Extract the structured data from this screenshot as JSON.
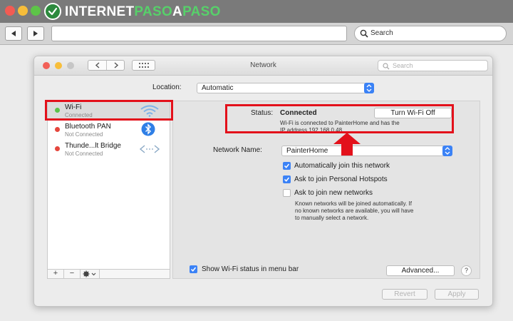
{
  "brand": {
    "part1": "INTERNET",
    "part2": "PASO",
    "part3": "A",
    "part4": "PASO"
  },
  "browser": {
    "search_text": "Search",
    "address_value": ""
  },
  "window": {
    "title": "Network",
    "search_placeholder": "Search",
    "location_label": "Location:",
    "location_value": "Automatic"
  },
  "services": [
    {
      "name": "Wi-Fi",
      "status": "Connected",
      "dot_color": "#5cc24a",
      "icon": "wifi-icon"
    },
    {
      "name": "Bluetooth PAN",
      "status": "Not Connected",
      "dot_color": "#e5463d",
      "icon": "bluetooth-icon"
    },
    {
      "name": "Thunde...lt Bridge",
      "status": "Not Connected",
      "dot_color": "#e5463d",
      "icon": "thunderbolt-bridge-icon"
    }
  ],
  "sidebar_footer": {
    "add": "+",
    "remove": "−"
  },
  "detail": {
    "status_label": "Status:",
    "status_value": "Connected",
    "turn_off_button": "Turn Wi-Fi Off",
    "status_desc_line1": "Wi-Fi is connected to PainterHome and has the",
    "status_desc_line2": "IP address 192.168.0.48.",
    "network_name_label": "Network Name:",
    "network_name_value": "PainterHome",
    "options": [
      {
        "label": "Automatically join this network",
        "checked": true
      },
      {
        "label": "Ask to join Personal Hotspots",
        "checked": true
      },
      {
        "label": "Ask to join new networks",
        "checked": false
      }
    ],
    "note_line1": "Known networks will be joined automatically. If",
    "note_line2": "no known networks are available, you will have",
    "note_line3": "to manually select a network.",
    "show_status_label": "Show Wi-Fi status in menu bar",
    "advanced_button": "Advanced...",
    "help_button": "?"
  },
  "footer": {
    "revert_button": "Revert",
    "apply_button": "Apply"
  },
  "colors": {
    "annotation": "#e3111b",
    "accent": "#3b82f6"
  }
}
